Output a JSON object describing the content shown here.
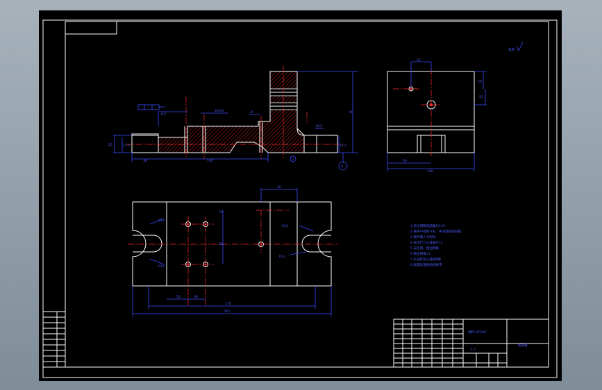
{
  "drawing": {
    "roughness_note": "其余",
    "dims": {
      "w_9": "9",
      "w_12_5": "12.5",
      "w_8": "8",
      "w_40": "40",
      "w_R12": "R12",
      "w_8_5": "8.5",
      "w_25": "25",
      "w_35": "35",
      "w_50": "50",
      "w_70": "70",
      "w_50b": "50",
      "w_140": "140",
      "w_53": "53",
      "w_60": "60",
      "w_80": "80",
      "w_90": "90",
      "w_85": "85",
      "w_170": "170",
      "w_240": "240",
      "w_38": "38",
      "w_R12b": "R12",
      "w_R12c": "R12",
      "w_R12d": "R12",
      "w_R12e": "R12",
      "w_38b": "38",
      "w_38c": "38",
      "w_98": "98",
      "w_2040": "20/40",
      "w_3": "3"
    },
    "datum": "A",
    "tech_reqs": [
      "1.未注明铸造圆角R3-10",
      "2.铸件不得有气孔、夹渣等铸造缺陷",
      "3.铸件需人工时效",
      "4.未注尺寸公差按IT14",
      "5.去毛刺、锐边倒钝",
      "6.锐边倒角C1",
      "7.未注形位公差按K级",
      "8.表面处理按图纸要求"
    ],
    "title_block": {
      "material": "材料:HT200",
      "name": "底座板",
      "scale": "1:1"
    }
  }
}
